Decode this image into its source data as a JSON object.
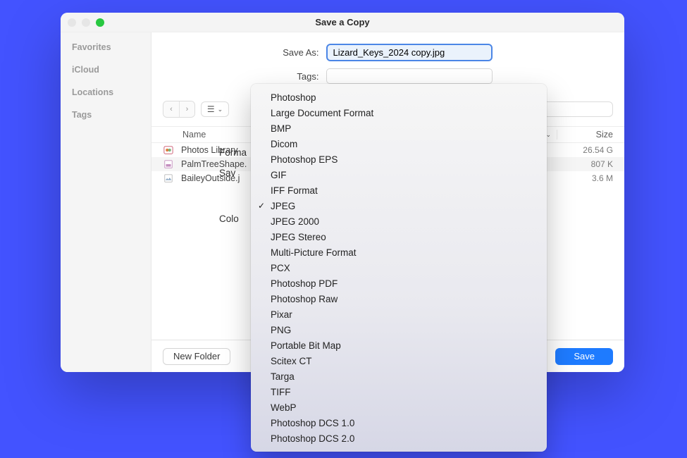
{
  "window": {
    "title": "Save a Copy"
  },
  "form": {
    "save_as_label": "Save As:",
    "save_as_value": "Lizard_Keys_2024 copy.jpg",
    "tags_label": "Tags:",
    "tags_value": ""
  },
  "sidebar": {
    "items": [
      {
        "label": "Favorites"
      },
      {
        "label": "iCloud"
      },
      {
        "label": "Locations"
      },
      {
        "label": "Tags"
      }
    ]
  },
  "toolbar": {
    "search_placeholder": ""
  },
  "columns": {
    "name": "Name",
    "size": "Size"
  },
  "files": [
    {
      "name": "Photos Library",
      "size": "26.54 G"
    },
    {
      "name": "PalmTreeShape.",
      "size": "807 K"
    },
    {
      "name": "BaileyOutside.j",
      "size": "3.6 M"
    }
  ],
  "labels": {
    "format": "Forma",
    "save": "Sav",
    "color": "Colo"
  },
  "footer": {
    "new_folder": "New Folder",
    "save_cloud": "Save",
    "save": "Save"
  },
  "format_dropdown": {
    "selected": "JPEG",
    "options": [
      "Photoshop",
      "Large Document Format",
      "BMP",
      "Dicom",
      "Photoshop EPS",
      "GIF",
      "IFF Format",
      "JPEG",
      "JPEG 2000",
      "JPEG Stereo",
      "Multi-Picture Format",
      "PCX",
      "Photoshop PDF",
      "Photoshop Raw",
      "Pixar",
      "PNG",
      "Portable Bit Map",
      "Scitex CT",
      "Targa",
      "TIFF",
      "WebP",
      "Photoshop DCS 1.0",
      "Photoshop DCS 2.0"
    ]
  }
}
